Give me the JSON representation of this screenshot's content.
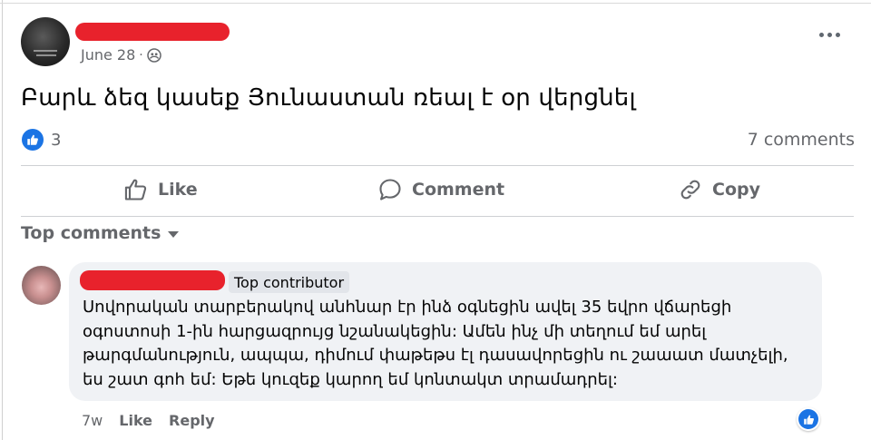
{
  "post": {
    "author_name": "",
    "date": "June 28",
    "date_separator": "·",
    "privacy_icon": "friends-icon",
    "text": "Բարև ձեզ կասեք Յունաստան ռեալ է օր վերցնել",
    "like_count": "3",
    "comments_count": "7 comments"
  },
  "actions": {
    "like_label": "Like",
    "comment_label": "Comment",
    "copy_label": "Copy"
  },
  "comments_filter": {
    "label": "Top comments"
  },
  "comment": {
    "author_name": "",
    "badge": "Top contributor",
    "lines": [
      "Սովորական տարբերակով անհնար էր ինձ օգնեցին ավել 35 եվրո վճարեցի",
      "օգոստոսի 1-ին հարցազրույց նշանակեցին: Ամեն ինչ մի տեղում եմ արել",
      "թարգմանություն, ապպա, դիմում փաթեթս էլ դասավորեցին ու շաաատ մատչելի,",
      "ես շատ գոհ եմ: Եթե կուզեք կարող եմ կոնտակտ տրամադրել:"
    ],
    "time": "7w",
    "like_label": "Like",
    "reply_label": "Reply"
  },
  "colors": {
    "accent": "#1b74e4",
    "muted_text": "#65676b",
    "redaction": "#e8222c",
    "bubble": "#f0f2f5"
  }
}
